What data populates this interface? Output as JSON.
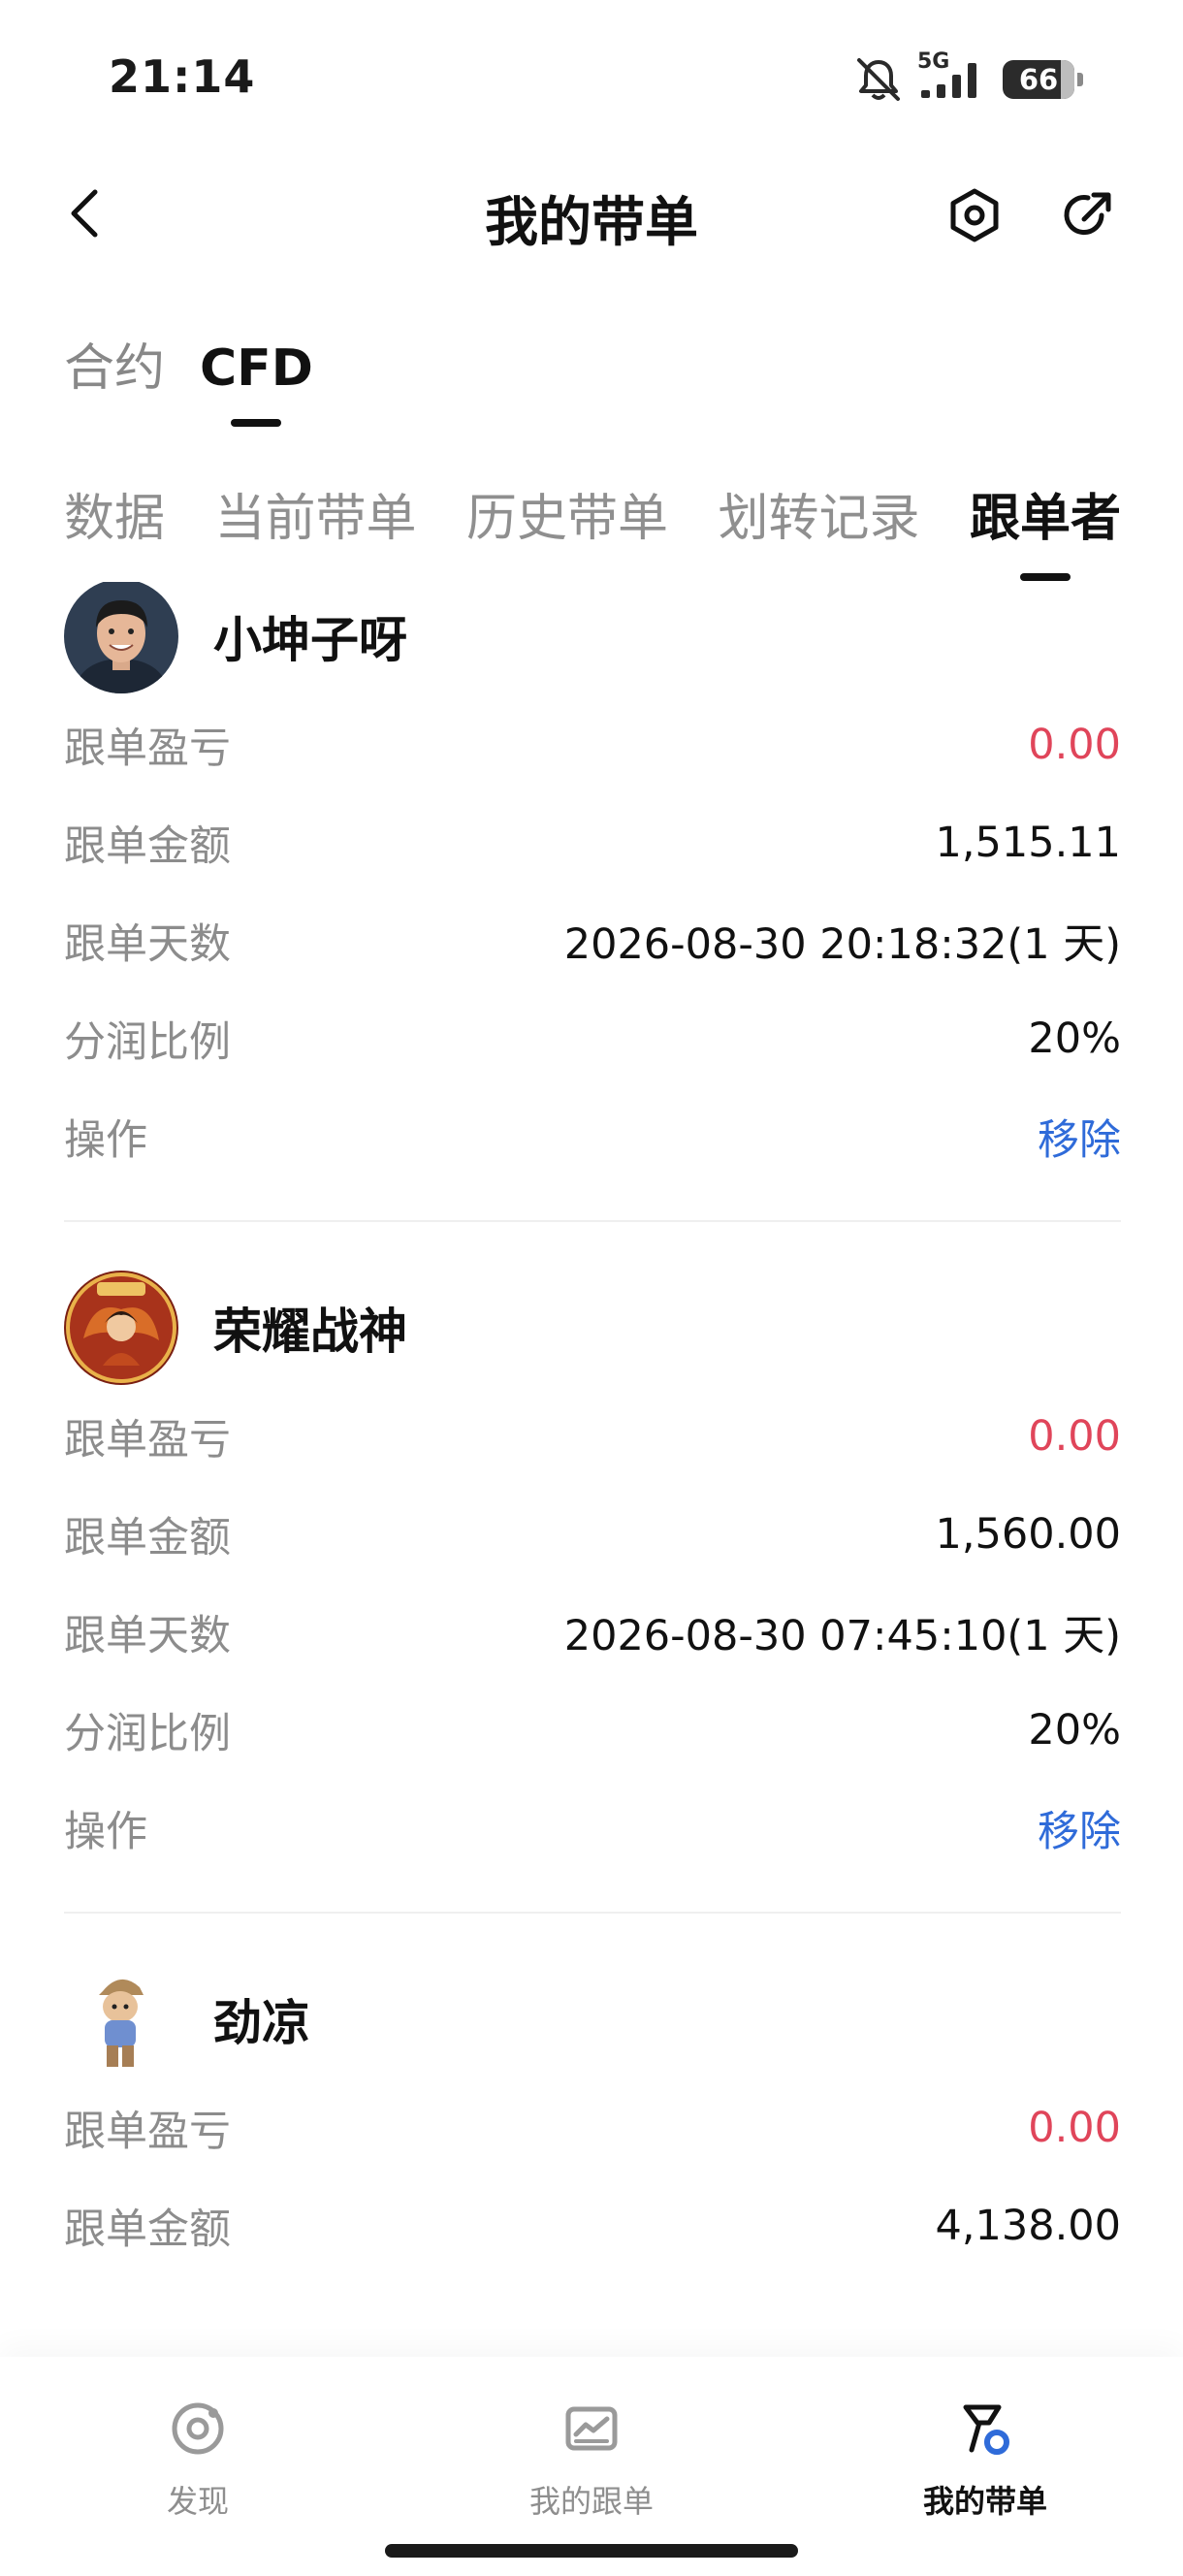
{
  "status_bar": {
    "time": "21:14",
    "network": "5G",
    "battery": "66"
  },
  "header": {
    "title": "我的带单"
  },
  "top_tabs": [
    {
      "label": "合约"
    },
    {
      "label": "CFD"
    }
  ],
  "sub_tabs": [
    {
      "label": "数据"
    },
    {
      "label": "当前带单"
    },
    {
      "label": "历史带单"
    },
    {
      "label": "划转记录"
    },
    {
      "label": "跟单者"
    }
  ],
  "followers": [
    {
      "name": "小坤子呀",
      "rows": [
        {
          "label": "跟单盈亏",
          "value": "0.00"
        },
        {
          "label": "跟单金额",
          "value": "1,515.11"
        },
        {
          "label": "跟单天数",
          "value": "2026-08-30 20:18:32(1 天)"
        },
        {
          "label": "分润比例",
          "value": "20%"
        },
        {
          "label": "操作",
          "value": "移除"
        }
      ]
    },
    {
      "name": "荣耀战神",
      "rows": [
        {
          "label": "跟单盈亏",
          "value": "0.00"
        },
        {
          "label": "跟单金额",
          "value": "1,560.00"
        },
        {
          "label": "跟单天数",
          "value": "2026-08-30 07:45:10(1 天)"
        },
        {
          "label": "分润比例",
          "value": "20%"
        },
        {
          "label": "操作",
          "value": "移除"
        }
      ]
    },
    {
      "name": "劲凉",
      "rows": [
        {
          "label": "跟单盈亏",
          "value": "0.00"
        },
        {
          "label": "跟单金额",
          "value": "4,138.00"
        }
      ]
    }
  ],
  "bottom_nav": [
    {
      "label": "发现"
    },
    {
      "label": "我的跟单"
    },
    {
      "label": "我的带单"
    }
  ],
  "colors": {
    "pnl": "#e0455a",
    "action": "#2f6bd9",
    "accent_ring": "#2f6bd9"
  }
}
